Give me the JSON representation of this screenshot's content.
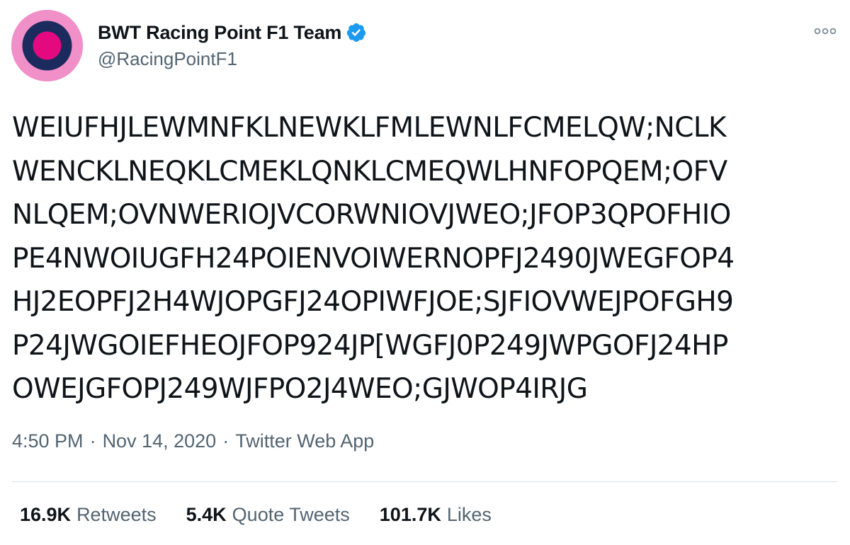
{
  "author": {
    "display_name": "BWT Racing Point F1 Team",
    "handle": "@RacingPointF1",
    "verified": true,
    "avatar_icon": "roundel-logo-icon",
    "colors": {
      "avatar_outer": "#f08fc8",
      "avatar_ring": "#1b2b5e",
      "avatar_center": "#e5097f",
      "verified_badge": "#1d9bf0"
    }
  },
  "tweet": {
    "lines": [
      "WEIUFHJLEWMNFKLNEWKLFMLEWNLFCMELQW;NCLK",
      "WENCKLNEQKLCMEKLQNKLCMEQWLHNFOPQEM;OFV",
      "NLQEM;OVNWERIOJVCORWNIOVJWEO;JFOP3QPOFHIO",
      "PE4NWOIUGFH24POIENVOIWERNOPFJ2490JWEGFOP4",
      "HJ2EOPFJ2H4WJOPGFJ24OPIWFJOE;SJFIOVWEJPOFGH9",
      "P24JWGOIEFHEOJFOP924JP[WGFJ0P249JWPGOFJ24HP",
      "OWEJGFOPJ249WJFPO2J4WEO;GJWOP4IRJG"
    ],
    "time": "4:50 PM",
    "date": "Nov 14, 2020",
    "source": "Twitter Web App",
    "separator": "·"
  },
  "stats": {
    "retweets": {
      "count": "16.9K",
      "label": "Retweets"
    },
    "quote_tweets": {
      "count": "5.4K",
      "label": "Quote Tweets"
    },
    "likes": {
      "count": "101.7K",
      "label": "Likes"
    }
  },
  "more_icon": "more-options-icon"
}
